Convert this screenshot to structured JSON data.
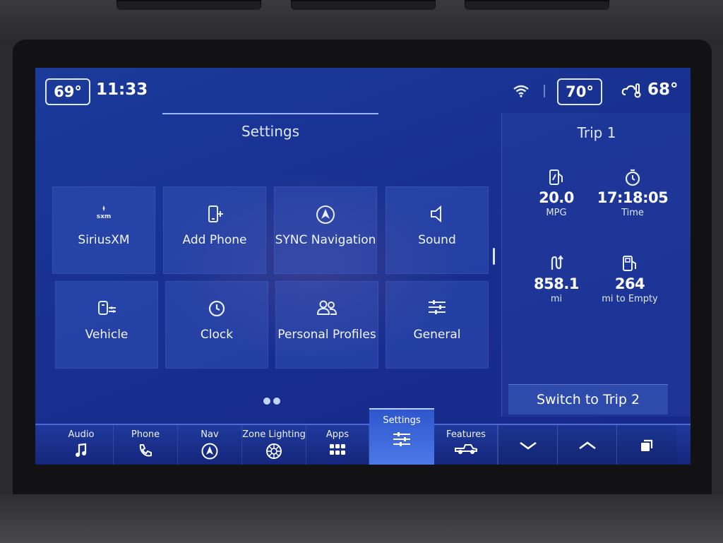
{
  "status": {
    "driver_temp": "69°",
    "time": "11:33",
    "passenger_temp": "70°",
    "outside_temp": "68°"
  },
  "settings": {
    "title": "Settings",
    "tiles": [
      {
        "label": "SiriusXM",
        "icon": "siriusxm-icon",
        "icon_text": "sxm"
      },
      {
        "label": "Add Phone",
        "icon": "add-phone-icon"
      },
      {
        "label": "SYNC Navigation",
        "icon": "navigation-icon"
      },
      {
        "label": "Sound",
        "icon": "speaker-icon"
      },
      {
        "label": "Vehicle",
        "icon": "vehicle-settings-icon"
      },
      {
        "label": "Clock",
        "icon": "clock-icon"
      },
      {
        "label": "Personal Profiles",
        "icon": "profiles-icon"
      },
      {
        "label": "General",
        "icon": "sliders-icon"
      }
    ],
    "page_indicator": {
      "pages": 2,
      "current": 1
    }
  },
  "trip": {
    "title": "Trip 1",
    "stats": [
      {
        "value": "20.0",
        "unit": "MPG",
        "icon": "fuel-economy-icon"
      },
      {
        "value": "17:18:05",
        "unit": "Time",
        "icon": "stopwatch-icon"
      },
      {
        "value": "858.1",
        "unit": "mi",
        "icon": "distance-icon"
      },
      {
        "value": "264",
        "unit": "mi to Empty",
        "icon": "fuel-pump-icon"
      }
    ],
    "switch_button": "Switch to Trip 2"
  },
  "nav": {
    "items": [
      {
        "label": "Audio",
        "icon": "music-note-icon"
      },
      {
        "label": "Phone",
        "icon": "phone-icon"
      },
      {
        "label": "Nav",
        "icon": "navigation-icon"
      },
      {
        "label": "Zone Lighting",
        "icon": "zone-lighting-icon"
      },
      {
        "label": "Apps",
        "icon": "apps-grid-icon"
      },
      {
        "label": "Settings",
        "icon": "settings-sliders-icon",
        "active": true
      },
      {
        "label": "Features",
        "icon": "truck-icon"
      }
    ],
    "buttons": [
      "chevron-down-icon",
      "chevron-up-icon",
      "window-toggle-icon"
    ]
  },
  "colors": {
    "accent": "#4d7ae8",
    "background": "#183090",
    "text": "#e8eeff"
  }
}
